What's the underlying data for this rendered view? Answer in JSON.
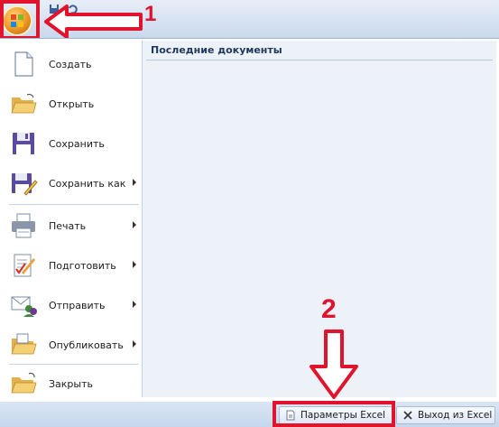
{
  "annotations": {
    "step1": "1",
    "step2": "2"
  },
  "colors": {
    "annotation": "#e0152d",
    "menu_title": "#1e395b"
  },
  "menu": {
    "items": [
      {
        "label": "Создать",
        "icon": "new-document-icon",
        "has_submenu": false
      },
      {
        "label": "Открыть",
        "icon": "open-folder-icon",
        "has_submenu": false
      },
      {
        "label": "Сохранить",
        "icon": "save-floppy-icon",
        "has_submenu": false
      },
      {
        "label": "Сохранить как",
        "icon": "save-as-icon",
        "has_submenu": true
      },
      {
        "label": "Печать",
        "icon": "printer-icon",
        "has_submenu": true
      },
      {
        "label": "Подготовить",
        "icon": "prepare-document-icon",
        "has_submenu": true
      },
      {
        "label": "Отправить",
        "icon": "send-mail-icon",
        "has_submenu": true
      },
      {
        "label": "Опубликовать",
        "icon": "publish-folder-icon",
        "has_submenu": true
      },
      {
        "label": "Закрыть",
        "icon": "close-folder-icon",
        "has_submenu": false
      }
    ],
    "recent_title": "Последние документы"
  },
  "footer": {
    "options_label": "Параметры Excel",
    "exit_label": "Выход из Excel"
  }
}
